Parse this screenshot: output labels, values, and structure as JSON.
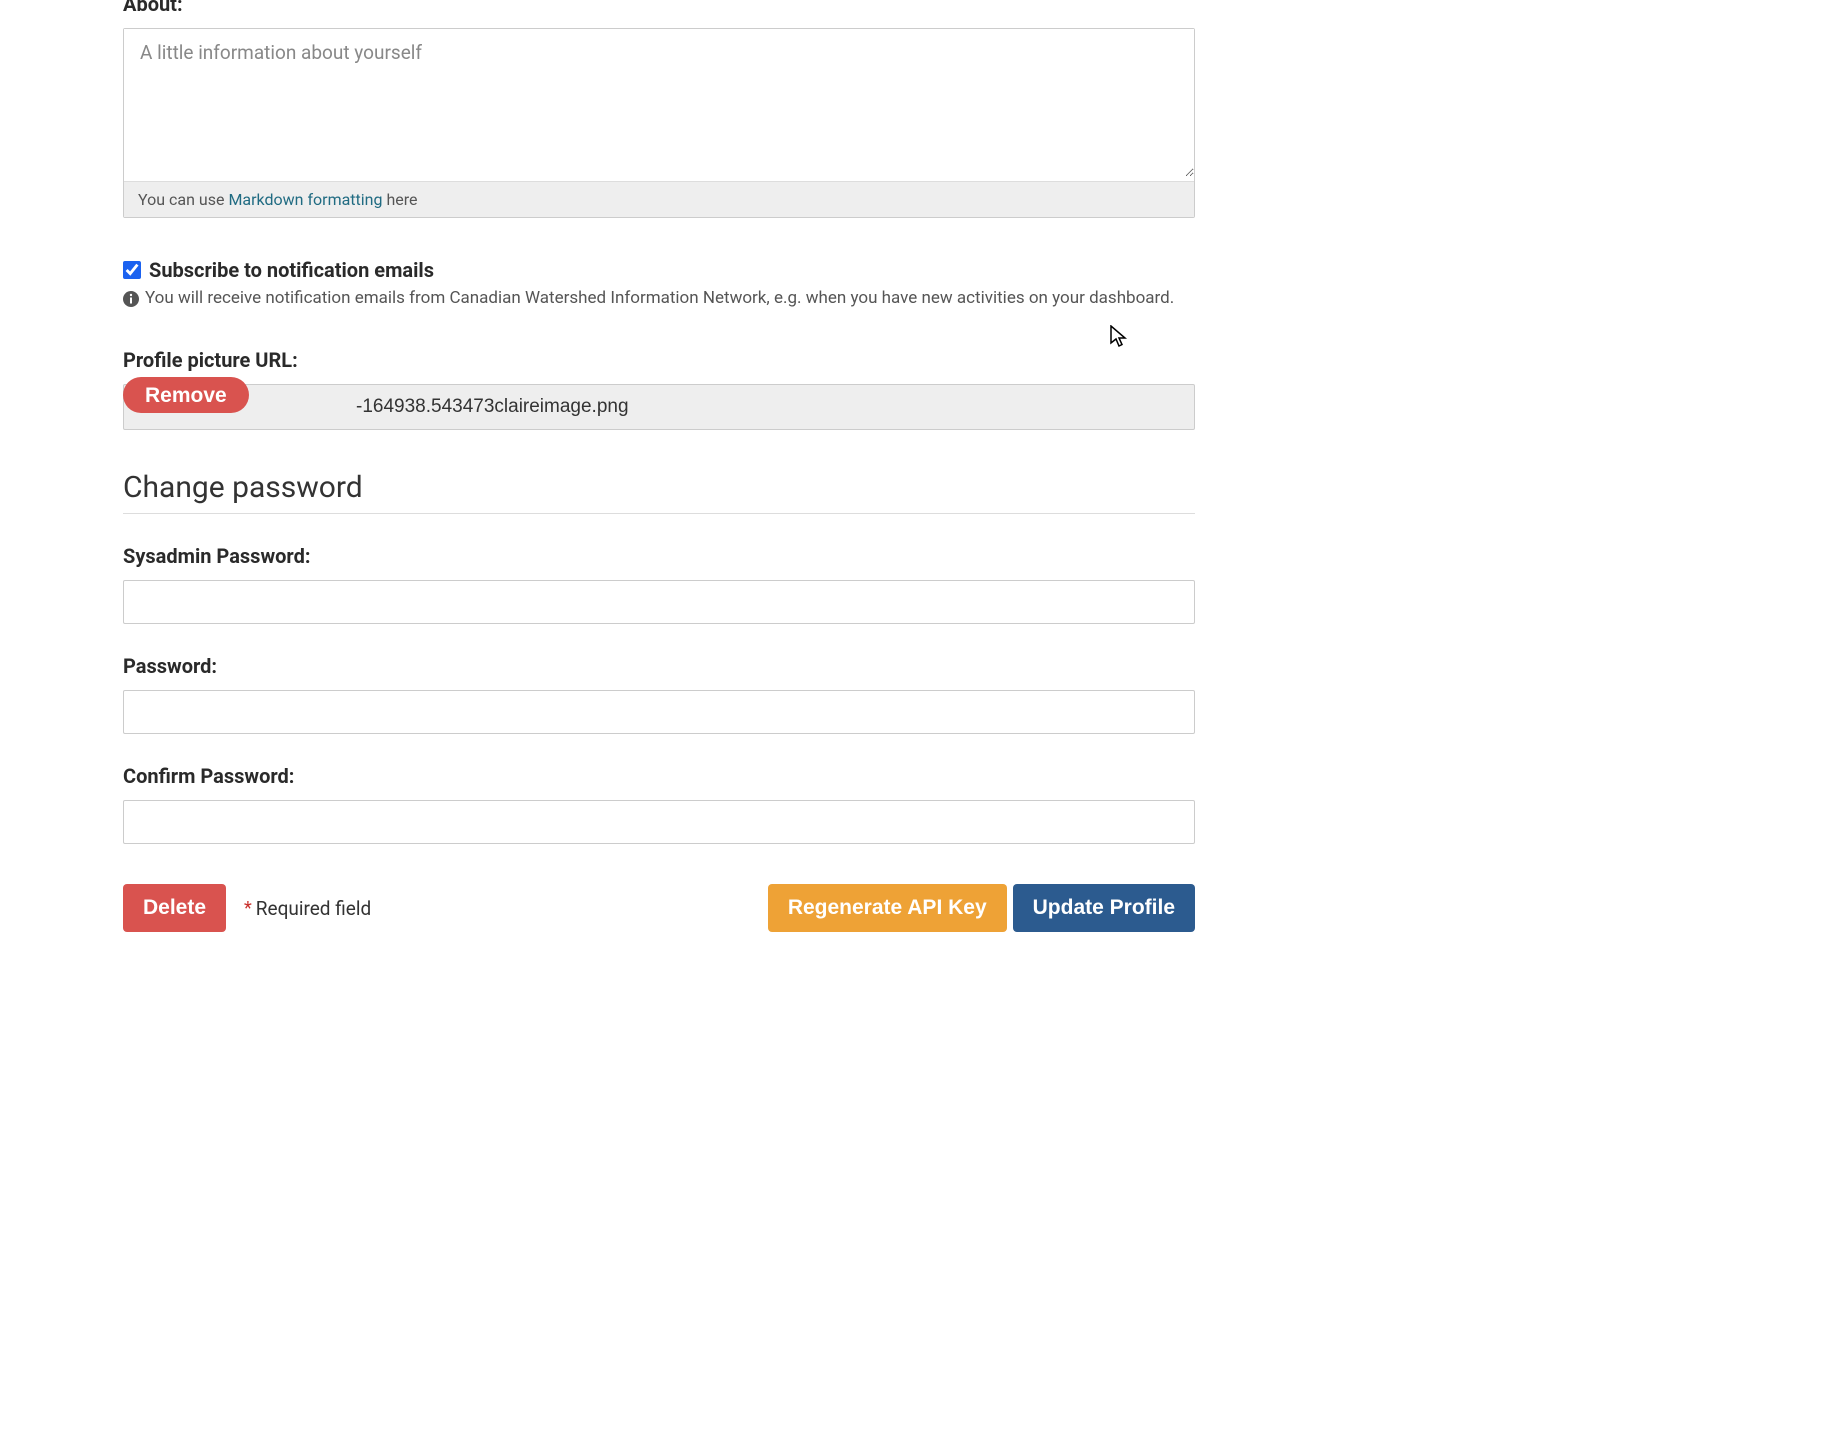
{
  "about": {
    "label": "About:",
    "placeholder": "A little information about yourself",
    "help_prefix": "You can use ",
    "help_link": "Markdown formatting",
    "help_suffix": " here"
  },
  "subscribe": {
    "label": "Subscribe to notification emails",
    "info": "You will receive notification emails from Canadian Watershed Information Network, e.g. when you have new activities on your dashboard."
  },
  "profile_picture": {
    "label": "Profile picture URL:",
    "remove_label": "Remove",
    "value": "-164938.543473claireimage.png"
  },
  "change_password": {
    "heading": "Change password",
    "sysadmin_label": "Sysadmin Password:",
    "password_label": "Password:",
    "confirm_label": "Confirm Password:"
  },
  "actions": {
    "delete_label": "Delete",
    "required_asterisk": "*",
    "required_text": "Required field",
    "regen_label": "Regenerate API Key",
    "update_label": "Update Profile"
  }
}
